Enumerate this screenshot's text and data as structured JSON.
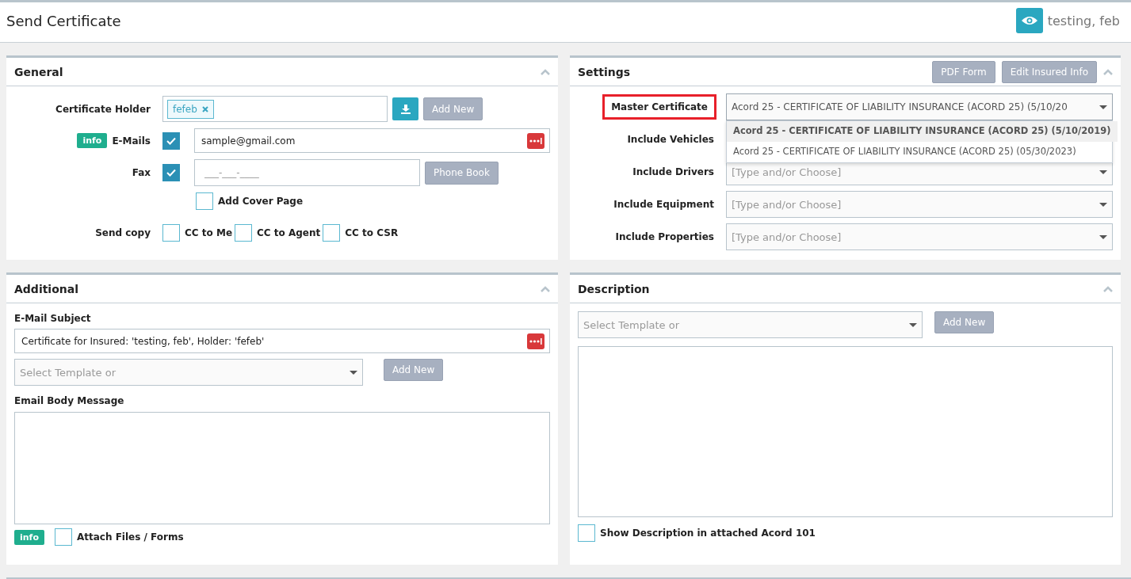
{
  "header": {
    "title": "Send Certificate",
    "user": "testing, feb"
  },
  "general": {
    "title": "General",
    "certificate_holder": {
      "label": "Certificate Holder",
      "tags": [
        "fefeb"
      ],
      "add_button": "Add New"
    },
    "emails": {
      "badge": "info",
      "label": "E-Mails",
      "checked": true,
      "value": "sample@gmail.com"
    },
    "fax": {
      "label": "Fax",
      "checked": true,
      "placeholder": "___-___-____",
      "button": "Phone Book"
    },
    "cover_page": {
      "label": "Add Cover Page",
      "checked": false
    },
    "send_copy": {
      "label": "Send copy",
      "options": [
        {
          "label": "CC to Me",
          "checked": false
        },
        {
          "label": "CC to Agent",
          "checked": false
        },
        {
          "label": "CC to CSR",
          "checked": false
        }
      ]
    }
  },
  "settings": {
    "title": "Settings",
    "buttons": [
      "PDF Form",
      "Edit Insured Info"
    ],
    "master_certificate": {
      "label": "Master Certificate",
      "highlighted": true,
      "value": "Acord 25 - CERTIFICATE OF LIABILITY INSURANCE (ACORD 25) (5/10/20",
      "expanded": true,
      "options": [
        {
          "label": "Acord 25 - CERTIFICATE OF LIABILITY INSURANCE (ACORD 25) (5/10/2019)",
          "selected": true
        },
        {
          "label": "Acord 25 - CERTIFICATE OF LIABILITY INSURANCE (ACORD 25) (05/30/2023)",
          "selected": false
        }
      ]
    },
    "includes": [
      {
        "label": "Include Vehicles"
      },
      {
        "label": "Include Drivers",
        "placeholder": "[Type and/or Choose]"
      },
      {
        "label": "Include Equipment",
        "placeholder": "[Type and/or Choose]"
      },
      {
        "label": "Include Properties",
        "placeholder": "[Type and/or Choose]"
      }
    ]
  },
  "additional": {
    "title": "Additional",
    "subject_label": "E-Mail Subject",
    "subject_value": "Certificate for Insured: 'testing, feb', Holder: 'fefeb'",
    "template_placeholder": "Select Template or",
    "add_button": "Add New",
    "body_label": "Email Body Message",
    "badge": "info",
    "attach": {
      "label": "Attach Files / Forms",
      "checked": false
    }
  },
  "description": {
    "title": "Description",
    "template_placeholder": "Select Template or",
    "add_button": "Add New",
    "show": {
      "label": "Show Description in attached Acord 101",
      "checked": false
    }
  }
}
